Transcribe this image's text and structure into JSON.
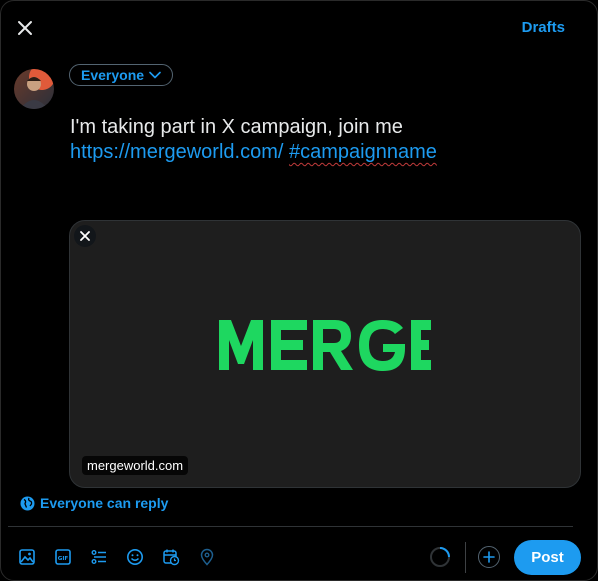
{
  "header": {
    "close_icon": "close-icon",
    "drafts_label": "Drafts"
  },
  "composer": {
    "audience_label": "Everyone",
    "text_line1": "I'm taking part in X campaign, join me",
    "link": "https://mergeworld.com/",
    "hashtag": "#campaignname"
  },
  "card": {
    "logo_text": "MERGE",
    "domain": "mergeworld.com",
    "logo_color": "#1ed760"
  },
  "reply": {
    "label": "Everyone can reply"
  },
  "toolbar": {
    "icons": [
      "media-icon",
      "gif-icon",
      "poll-icon",
      "emoji-icon",
      "schedule-icon",
      "location-icon"
    ],
    "post_label": "Post"
  },
  "colors": {
    "accent": "#1d9bf0",
    "background": "#000000"
  }
}
